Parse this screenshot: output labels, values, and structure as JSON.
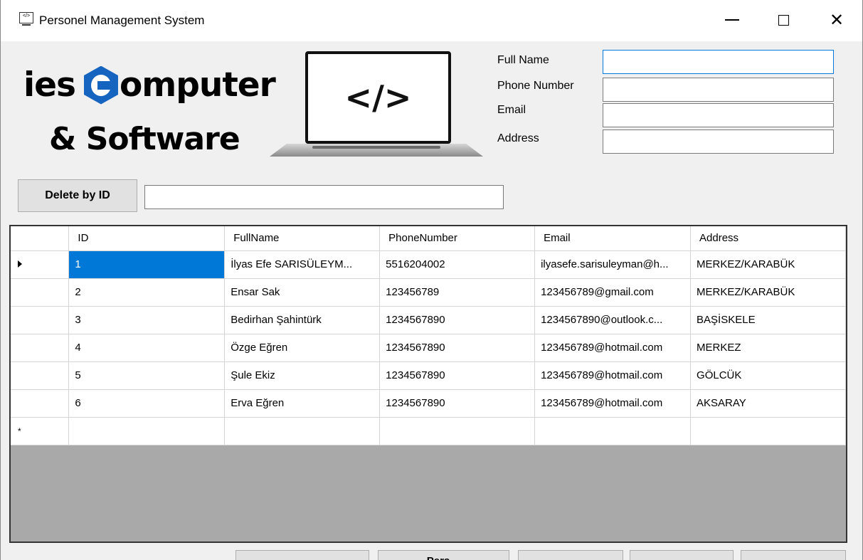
{
  "window": {
    "title": "Personel Management System"
  },
  "logo": {
    "line1_a": "ies",
    "line1_b": "omputer",
    "line2": "& Software",
    "laptop_glyph": "</>"
  },
  "form": {
    "fullname_label": "Full Name",
    "phone_label": "Phone Number",
    "email_label": "Email",
    "address_label": "Address",
    "fullname_value": "",
    "phone_value": "",
    "email_value": "",
    "address_value": ""
  },
  "delete": {
    "button_label": "Delete by ID",
    "input_value": ""
  },
  "grid": {
    "columns": [
      "ID",
      "FullName",
      "PhoneNumber",
      "Email",
      "Address"
    ],
    "rows": [
      [
        "1",
        "İlyas Efe SARISÜLEYM...",
        "5516204002",
        "ilyasefe.sarisuleyman@h...",
        "MERKEZ/KARABÜK"
      ],
      [
        "2",
        "Ensar Sak",
        "123456789",
        "123456789@gmail.com",
        "MERKEZ/KARABÜK"
      ],
      [
        "3",
        "Bedirhan Şahintürk",
        "1234567890",
        "1234567890@outlook.c...",
        "BAŞİSKELE"
      ],
      [
        "4",
        "Özge Eğren",
        "1234567890",
        "123456789@hotmail.com",
        "MERKEZ"
      ],
      [
        "5",
        "Şule Ekiz",
        "1234567890",
        "123456789@hotmail.com",
        "GÖLCÜK"
      ],
      [
        "6",
        "Erva Eğren",
        "1234567890",
        "123456789@hotmail.com",
        "AKSARAY"
      ]
    ],
    "current_row_glyph": "▶",
    "new_row_glyph": "*"
  },
  "bottom_buttons": [
    "",
    "Pers…",
    "",
    "",
    ""
  ],
  "colors": {
    "selection": "#0078d7",
    "logo_blue": "#1565c0",
    "grid_background": "#a9a9a9"
  }
}
